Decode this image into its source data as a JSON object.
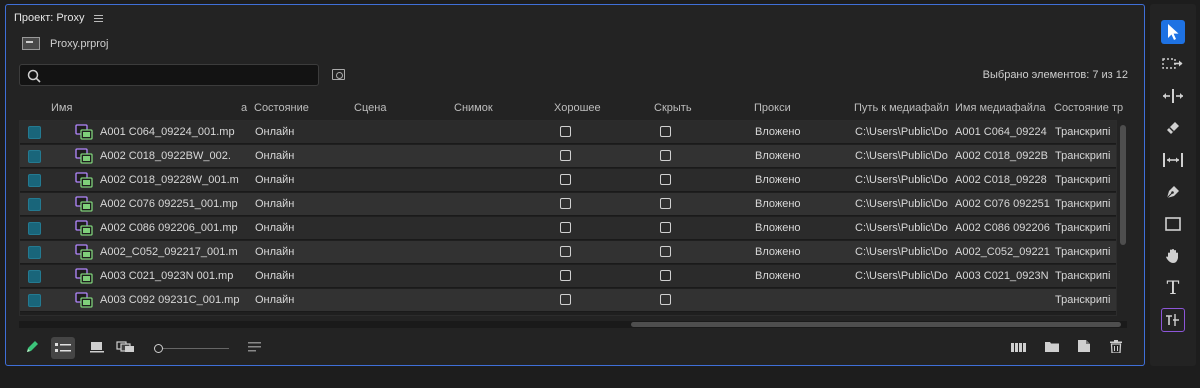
{
  "panel": {
    "title": "Проект: Proxy",
    "project_file": "Proxy.prproj",
    "search": {
      "value": "",
      "placeholder": ""
    },
    "selection_info": "Выбрано элементов: 7 из 12"
  },
  "columns": {
    "name": "Имя",
    "sort_indicator": "a",
    "status": "Состояние",
    "scene": "Сцена",
    "shot": "Снимок",
    "good": "Хорошее",
    "hide": "Скрыть",
    "proxy": "Прокси",
    "media_path": "Путь к медиафайл",
    "media_name": "Имя медиафайла",
    "transcript_status": "Состояние тр"
  },
  "rows": [
    {
      "name": "A001 C064_09224_001.mp",
      "status": "Онлайн",
      "proxy": "Вложено",
      "path": "C:\\Users\\Public\\Do",
      "media": "A001 C064_09224",
      "transcript": "Транскрипі"
    },
    {
      "name": "A002 C018_0922BW_002.",
      "status": "Онлайн",
      "proxy": "Вложено",
      "path": "C:\\Users\\Public\\Do",
      "media": "A002 C018_0922B",
      "transcript": "Транскрипі"
    },
    {
      "name": "A002 C018_09228W_001.m",
      "status": "Онлайн",
      "proxy": "Вложено",
      "path": "C:\\Users\\Public\\Do",
      "media": "A002 C018_09228",
      "transcript": "Транскрипі"
    },
    {
      "name": "A002 C076 092251_001.mp",
      "status": "Онлайн",
      "proxy": "Вложено",
      "path": "C:\\Users\\Public\\Do",
      "media": "A002 C076 092251",
      "transcript": "Транскрипі"
    },
    {
      "name": "A002 C086 092206_001.mp",
      "status": "Онлайн",
      "proxy": "Вложено",
      "path": "C:\\Users\\Public\\Do",
      "media": "A002 C086 092206",
      "transcript": "Транскрипі"
    },
    {
      "name": "A002_C052_092217_001.m",
      "status": "Онлайн",
      "proxy": "Вложено",
      "path": "C:\\Users\\Public\\Do",
      "media": "A002_C052_09221",
      "transcript": "Транскрипі"
    },
    {
      "name": "A003 C021_0923N 001.mp",
      "status": "Онлайн",
      "proxy": "Вложено",
      "path": "C:\\Users\\Public\\Do",
      "media": "A003 C021_0923N",
      "transcript": "Транскрипі"
    },
    {
      "name": "A003 C092 09231C_001.mp",
      "status": "Онлайн",
      "proxy": "",
      "path": "",
      "media": "",
      "transcript": "Транскрипі"
    }
  ],
  "colors": {
    "accent": "#1e72e3",
    "panel_border": "#3f6fd8",
    "label_swatch": "#19657a",
    "clip_icon": "#7fd07a",
    "clip_icon_alt": "#b388ff"
  },
  "bottom_icons": [
    "pencil-icon",
    "list-view-icon",
    "icon-view-icon",
    "freeform-view-icon",
    "zoom-slider",
    "sort-icon",
    "automate-to-sequence-icon",
    "new-bin-icon",
    "new-item-icon",
    "trash-icon"
  ],
  "tool_icons": [
    "selection-tool-icon",
    "track-select-tool-icon",
    "ripple-edit-tool-icon",
    "razor-tool-icon",
    "slip-tool-icon",
    "pen-tool-icon",
    "rectangle-tool-icon",
    "hand-tool-icon",
    "type-tool-icon",
    "transcript-tool-icon"
  ]
}
